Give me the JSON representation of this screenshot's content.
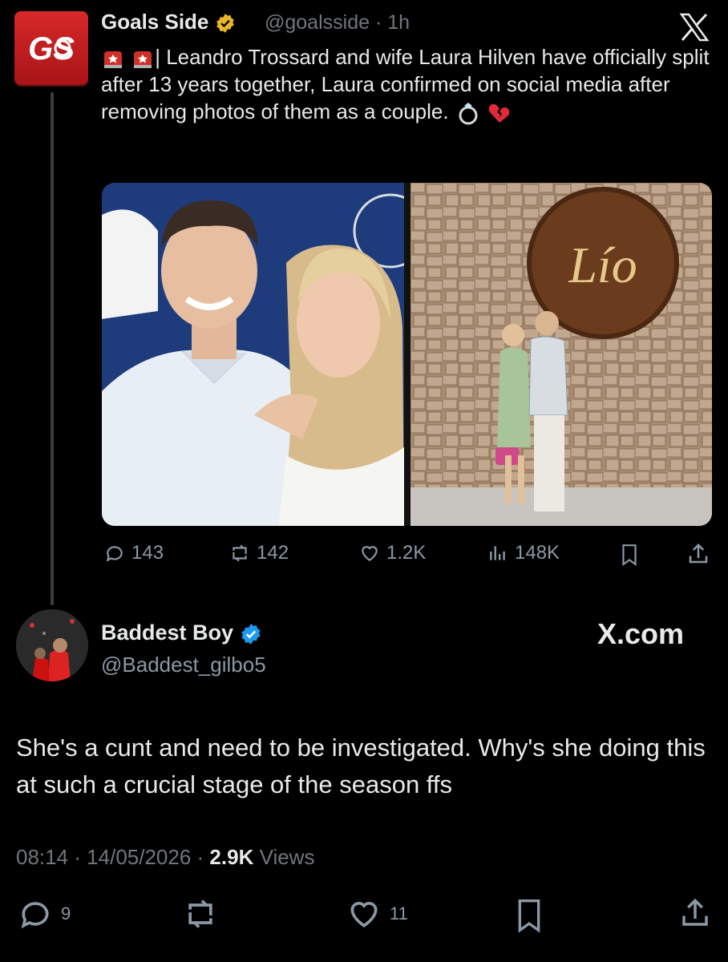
{
  "tweet": {
    "author_name": "Goals Side",
    "handle": "@goalsside",
    "time": "· 1h",
    "text": "| Leandro Trossard and wife Laura Hilven have officially split after 13 years together, Laura confirmed on social media after removing photos of them as a couple.",
    "photo_sign_text": "Lío",
    "metrics": {
      "replies": "143",
      "reposts": "142",
      "likes": "1.2K",
      "views": "148K"
    }
  },
  "reply": {
    "author_name": "Baddest Boy",
    "handle": "@Baddest_gilbo5",
    "site": "X.com",
    "text": "She's a cunt and need to be investigated. Why's she doing this at such a crucial stage of the season ffs",
    "timestamp": "08:14 · 14/05/2026 ·",
    "views_count": "2.9K",
    "views_label": "Views",
    "replies": "9",
    "likes": "11"
  },
  "colors": {
    "background": "#000000",
    "text": "#e7e9ea",
    "muted": "#71767b",
    "verified_gold": "#e8b829",
    "verified_blue": "#1d9bf0",
    "brand_red": "#d8282a"
  },
  "icons": [
    "goals-side-logo-icon",
    "verified-gold-icon",
    "x-logo-icon",
    "siren-icon",
    "ring-icon",
    "broken-heart-icon",
    "reply-icon",
    "repost-icon",
    "like-icon",
    "views-icon",
    "bookmark-icon",
    "share-icon",
    "verified-blue-icon"
  ]
}
